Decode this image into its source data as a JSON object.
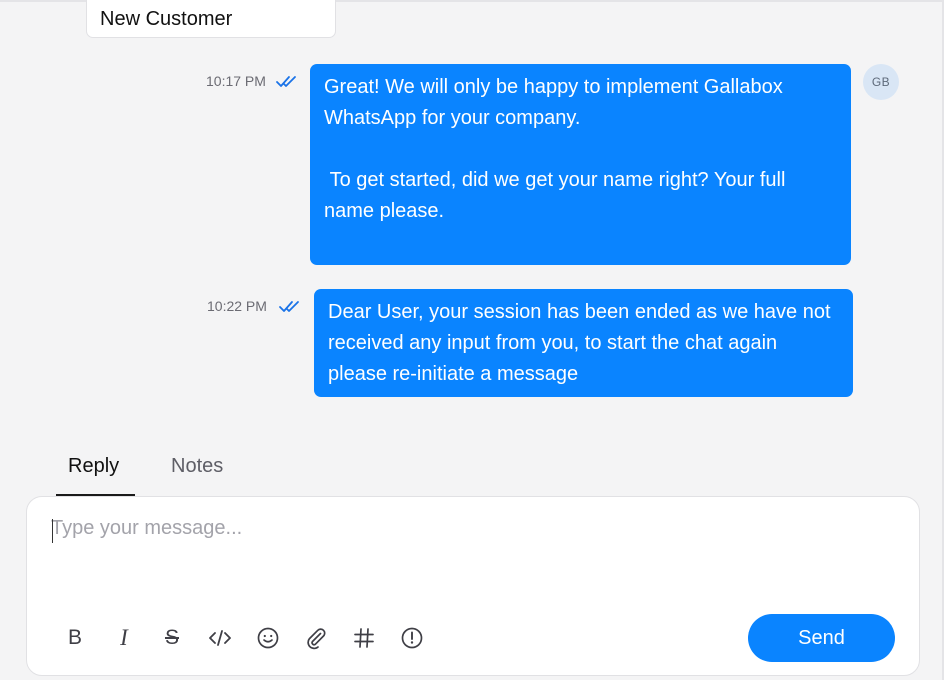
{
  "option": {
    "label": "New Customer"
  },
  "messages": [
    {
      "time": "10:17 PM",
      "text": "Great! We will only be happy to implement Gallabox WhatsApp for your company.\n\n To get started, did we get your name right? Your full name please.",
      "status_icon": "double-check-icon"
    },
    {
      "time": "10:22 PM",
      "text": "Dear User, your session has been ended as we have not received any input from you, to start the chat again please re-initiate a message",
      "status_icon": "double-check-icon"
    }
  ],
  "avatar": {
    "initials": "GB"
  },
  "tabs": [
    {
      "label": "Reply",
      "active": true
    },
    {
      "label": "Notes",
      "active": false
    }
  ],
  "composer": {
    "value": "",
    "placeholder": "Type your message...",
    "send_label": "Send",
    "toolbar": [
      "bold-icon",
      "italic-icon",
      "strikethrough-icon",
      "code-icon",
      "emoji-icon",
      "attachment-icon",
      "hashtag-icon",
      "alert-icon"
    ]
  },
  "colors": {
    "accent": "#0a84ff",
    "background": "#f4f4f5",
    "tick": "#1a73e8"
  }
}
